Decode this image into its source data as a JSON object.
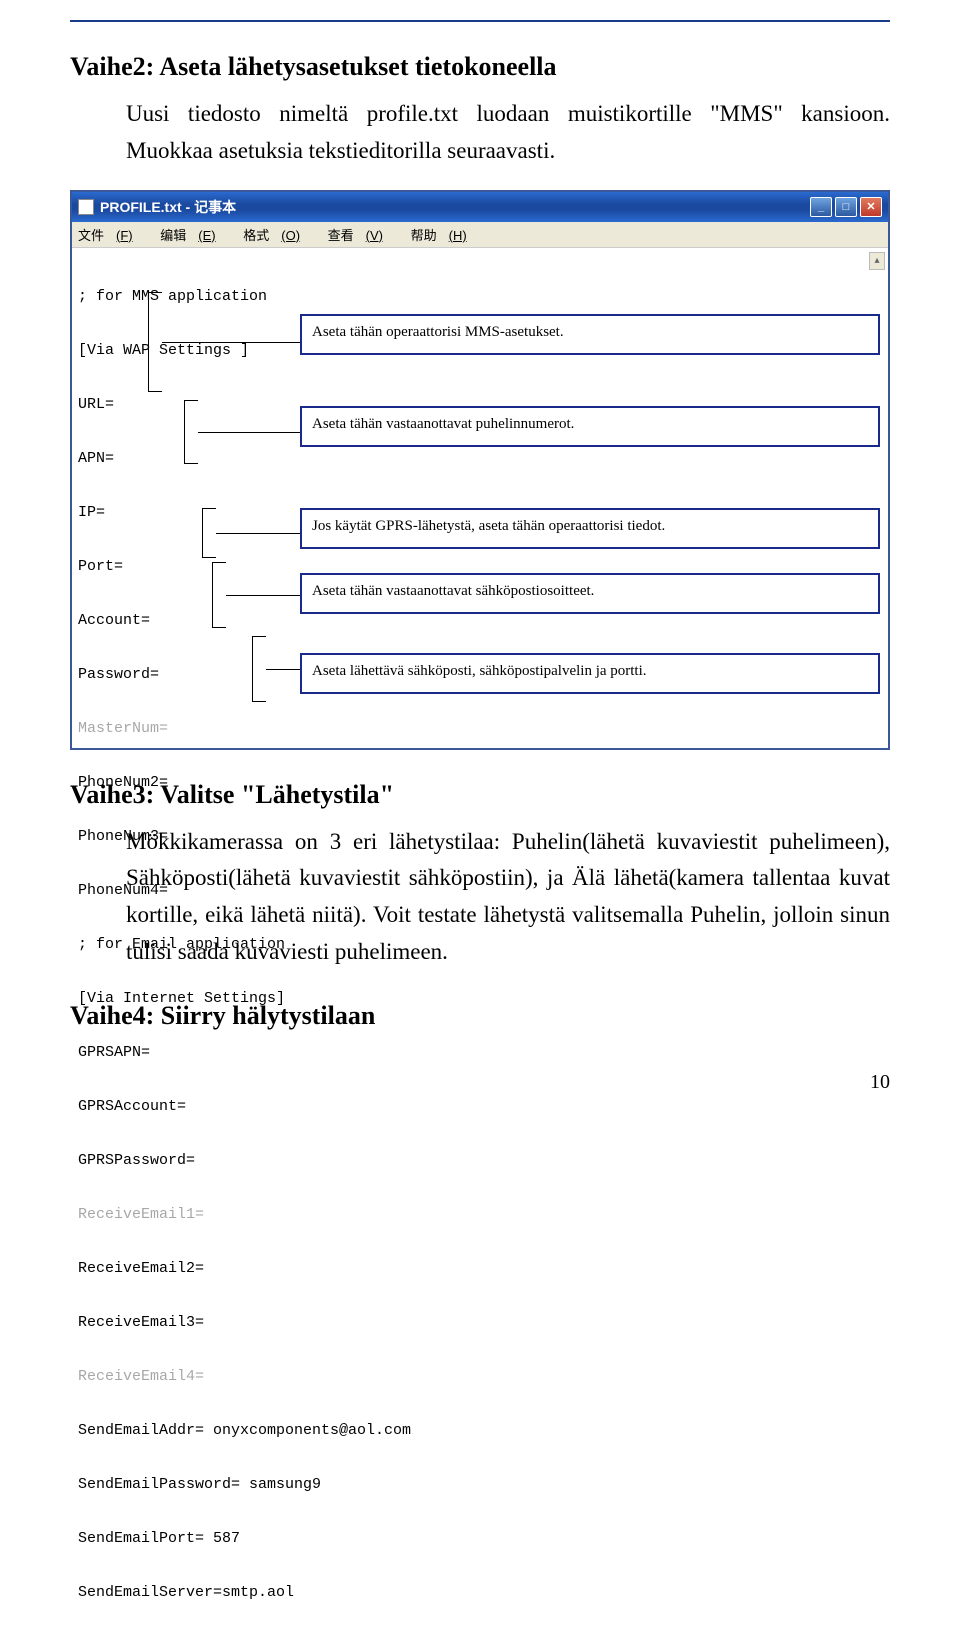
{
  "section1": {
    "title": "Vaihe2: Aseta lähetysasetukset tietokoneella",
    "body": "Uusi tiedosto nimeltä profile.txt luodaan muistikortille \"MMS\" kansioon. Muokkaa asetuksia tekstieditorilla seuraavasti."
  },
  "notepad": {
    "title": "PROFILE.txt - 记事本",
    "menu": {
      "file": "文件",
      "file_key": "(F)",
      "edit": "编辑",
      "edit_key": "(E)",
      "format": "格式",
      "format_key": "(O)",
      "view": "查看",
      "view_key": "(V)",
      "help": "帮助",
      "help_key": "(H)"
    },
    "lines": [
      "; for MMS application",
      "[Via WAP Settings ]",
      "URL=",
      "APN=",
      "IP=",
      "Port=",
      "Account=",
      "Password=",
      "MasterNum=",
      "PhoneNum2=",
      "PhoneNum3=",
      "PhoneNum4=",
      "; for Email application",
      "[Via Internet Settings]",
      "GPRSAPN=",
      "GPRSAccount=",
      "GPRSPassword=",
      "ReceiveEmail1=",
      "ReceiveEmail2=",
      "ReceiveEmail3=",
      "ReceiveEmail4=",
      "SendEmailAddr= onyxcomponents@aol.com",
      "SendEmailPassword= samsung9",
      "SendEmailPort= 587",
      "SendEmailServer=smtp.aol"
    ],
    "callouts": [
      {
        "text": "Aseta tähän operaattorisi MMS-asetukset."
      },
      {
        "text": "Aseta tähän vastaanottavat puhelinnumerot."
      },
      {
        "text": "Jos käytät GPRS-lähetystä, aseta tähän operaattorisi tiedot."
      },
      {
        "text": "Aseta tähän vastaanottavat sähköpostiosoitteet."
      },
      {
        "text": "Aseta lähettävä sähköposti, sähköpostipalvelin ja portti."
      }
    ]
  },
  "section2": {
    "title": "Vaihe3: Valitse \"Lähetystila\"",
    "body": "Mökkikamerassa on 3 eri lähetystilaa: Puhelin(lähetä kuvaviestit puhelimeen), Sähköposti(lähetä kuvaviestit sähköpostiin), ja Älä lähetä(kamera tallentaa kuvat kortille, eikä lähetä niitä). Voit testate lähetystä valitsemalla Puhelin, jolloin sinun tulisi saada kuvaviesti puhelimeen."
  },
  "section3": {
    "title": "Vaihe4: Siirry hälytystilaan"
  },
  "pagenum": "10"
}
